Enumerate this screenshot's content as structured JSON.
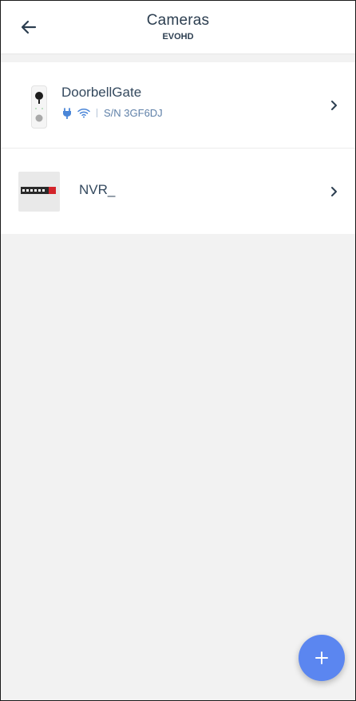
{
  "header": {
    "title": "Cameras",
    "subtitle": "EVOHD"
  },
  "devices": [
    {
      "name": "DoorbellGate",
      "serial": "S/N 3GF6DJ",
      "icons": [
        "power-plug-icon",
        "wifi-icon"
      ],
      "thumbnail": "doorbell"
    },
    {
      "name": "NVR_",
      "thumbnail": "provision-logo"
    }
  ],
  "fab": {
    "icon": "plus-icon"
  },
  "colors": {
    "accent": "#5b86f0",
    "status_icon": "#4a86d8",
    "background": "#f2f2f2",
    "text": "#34495e"
  }
}
